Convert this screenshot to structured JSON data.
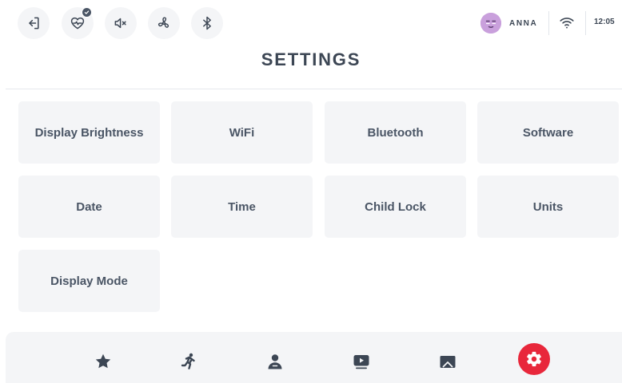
{
  "header": {
    "user_name": "ANNA",
    "time": "12:05",
    "icons": [
      "exit-icon",
      "heart-rate-icon",
      "volume-mute-icon",
      "fan-icon",
      "bluetooth-icon"
    ]
  },
  "page": {
    "title": "SETTINGS"
  },
  "settings": {
    "items": [
      {
        "label": "Display Brightness"
      },
      {
        "label": "WiFi"
      },
      {
        "label": "Bluetooth"
      },
      {
        "label": "Software"
      },
      {
        "label": "Date"
      },
      {
        "label": "Time"
      },
      {
        "label": "Child Lock"
      },
      {
        "label": "Units"
      },
      {
        "label": "Display Mode"
      }
    ]
  },
  "bottom_nav": {
    "items": [
      "favorites-star-icon",
      "running-workout-icon",
      "profile-icon",
      "video-play-icon",
      "scenery-image-icon",
      "settings-gear-icon"
    ],
    "active": "settings-gear-icon"
  },
  "colors": {
    "accent": "#e8273b",
    "text": "#3c4654",
    "tile_bg": "#f4f5f7",
    "avatar": "#c9a0dc"
  }
}
